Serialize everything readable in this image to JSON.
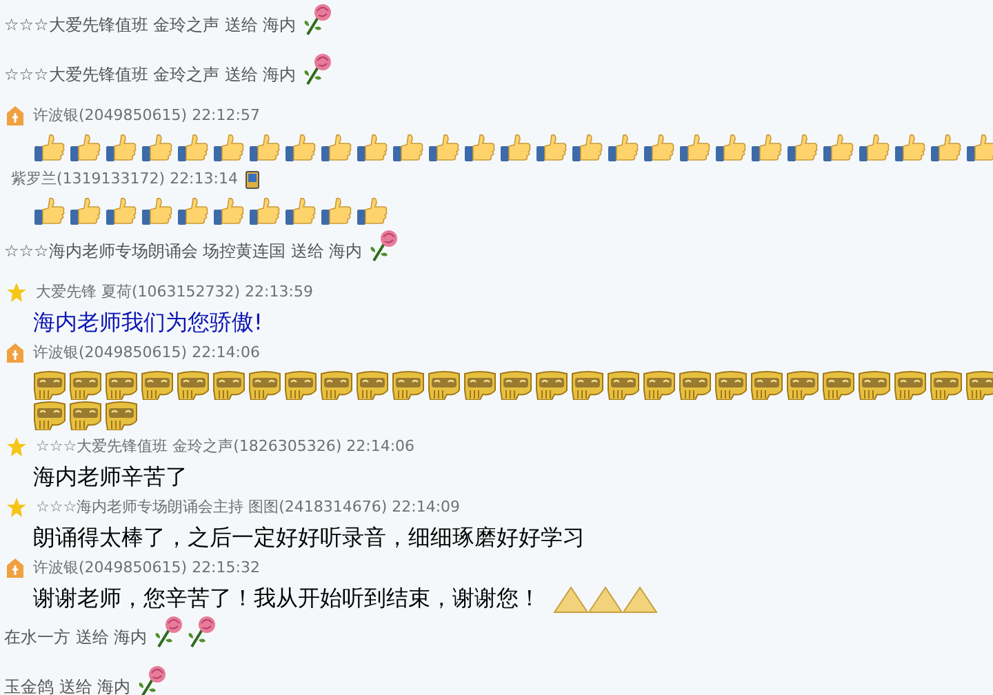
{
  "entries": [
    {
      "kind": "gift",
      "text": "☆☆☆大爱先锋值班 金玲之声 送给 海内",
      "gifts": [
        {
          "kind": "rose"
        }
      ]
    },
    {
      "kind": "gift",
      "text": "☆☆☆大爱先锋值班 金玲之声 送给 海内",
      "gifts": [
        {
          "kind": "rose"
        }
      ]
    },
    {
      "kind": "header",
      "badge": {
        "kind": "member"
      },
      "text": "许波银(2049850615) 22:12:57"
    },
    {
      "kind": "emojis",
      "emojis": [
        {
          "kind": "thumb"
        },
        {
          "kind": "thumb"
        },
        {
          "kind": "thumb"
        },
        {
          "kind": "thumb"
        },
        {
          "kind": "thumb"
        },
        {
          "kind": "thumb"
        },
        {
          "kind": "thumb"
        },
        {
          "kind": "thumb"
        },
        {
          "kind": "thumb"
        },
        {
          "kind": "thumb"
        },
        {
          "kind": "thumb"
        },
        {
          "kind": "thumb"
        },
        {
          "kind": "thumb"
        },
        {
          "kind": "thumb"
        },
        {
          "kind": "thumb"
        },
        {
          "kind": "thumb"
        },
        {
          "kind": "thumb"
        },
        {
          "kind": "thumb"
        },
        {
          "kind": "thumb"
        },
        {
          "kind": "thumb"
        },
        {
          "kind": "thumb"
        },
        {
          "kind": "thumb"
        },
        {
          "kind": "thumb"
        },
        {
          "kind": "thumb"
        },
        {
          "kind": "thumb"
        },
        {
          "kind": "thumb"
        },
        {
          "kind": "thumb"
        }
      ]
    },
    {
      "kind": "header",
      "text": "紫罗兰(1319133172) 22:13:14",
      "mobile": true
    },
    {
      "kind": "emojis",
      "emojis": [
        {
          "kind": "thumb"
        },
        {
          "kind": "thumb"
        },
        {
          "kind": "thumb"
        },
        {
          "kind": "thumb"
        },
        {
          "kind": "thumb"
        },
        {
          "kind": "thumb"
        },
        {
          "kind": "thumb"
        },
        {
          "kind": "thumb"
        },
        {
          "kind": "thumb"
        },
        {
          "kind": "thumb"
        }
      ]
    },
    {
      "kind": "gift",
      "text": "☆☆☆海内老师专场朗诵会 场控黄连国 送给 海内",
      "gifts": [
        {
          "kind": "rose"
        }
      ]
    },
    {
      "kind": "header",
      "badge": {
        "kind": "admin"
      },
      "text": "大爱先锋 夏荷(1063152732) 22:13:59"
    },
    {
      "kind": "text",
      "text": "海内老师我们为您骄傲!",
      "color": "#0a14b4"
    },
    {
      "kind": "header",
      "badge": {
        "kind": "member"
      },
      "text": "许波银(2049850615) 22:14:06"
    },
    {
      "kind": "emojis",
      "emojis": [
        {
          "kind": "cat"
        },
        {
          "kind": "cat"
        },
        {
          "kind": "cat"
        },
        {
          "kind": "cat"
        },
        {
          "kind": "cat"
        },
        {
          "kind": "cat"
        },
        {
          "kind": "cat"
        },
        {
          "kind": "cat"
        },
        {
          "kind": "cat"
        },
        {
          "kind": "cat"
        },
        {
          "kind": "cat"
        },
        {
          "kind": "cat"
        },
        {
          "kind": "cat"
        },
        {
          "kind": "cat"
        },
        {
          "kind": "cat"
        },
        {
          "kind": "cat"
        },
        {
          "kind": "cat"
        },
        {
          "kind": "cat"
        },
        {
          "kind": "cat"
        },
        {
          "kind": "cat"
        },
        {
          "kind": "cat"
        },
        {
          "kind": "cat"
        },
        {
          "kind": "cat"
        },
        {
          "kind": "cat"
        },
        {
          "kind": "cat"
        },
        {
          "kind": "cat"
        },
        {
          "kind": "cat"
        },
        {
          "kind": "cat"
        },
        {
          "kind": "cat"
        },
        {
          "kind": "cat"
        }
      ]
    },
    {
      "kind": "header",
      "badge": {
        "kind": "admin"
      },
      "text": "☆☆☆大爱先锋值班 金玲之声(1826305326) 22:14:06"
    },
    {
      "kind": "text",
      "text": "海内老师辛苦了",
      "color": "#000000"
    },
    {
      "kind": "header",
      "badge": {
        "kind": "admin"
      },
      "text": "☆☆☆海内老师专场朗诵会主持 图图(2418314676) 22:14:09"
    },
    {
      "kind": "text",
      "text": "朗诵得太棒了，之后一定好好听录音，细细琢磨好好学习",
      "color": "#000000"
    },
    {
      "kind": "header",
      "badge": {
        "kind": "member"
      },
      "text": "许波银(2049850615) 22:15:32"
    },
    {
      "kind": "text",
      "text": "谢谢老师，您辛苦了！我从开始听到结束，谢谢您！",
      "color": "#000000",
      "emojis": [
        {
          "kind": "clap"
        }
      ]
    },
    {
      "kind": "gift",
      "text": "在水一方 送给 海内",
      "gifts": [
        {
          "kind": "rose"
        },
        {
          "kind": "rose"
        }
      ]
    },
    {
      "kind": "gift",
      "text": "玉金鸽 送给 海内",
      "gifts": [
        {
          "kind": "rose"
        }
      ]
    }
  ]
}
